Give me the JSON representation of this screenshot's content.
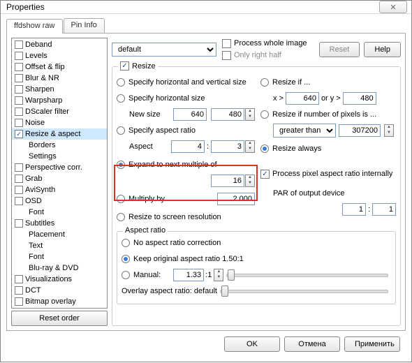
{
  "window": {
    "title": "Properties",
    "close_glyph": "✕"
  },
  "tabs": {
    "t0": "ffdshow raw",
    "t1": "Pin Info"
  },
  "tree": {
    "items": [
      {
        "label": "Deband",
        "lvl": 0,
        "cb": true,
        "ch": false
      },
      {
        "label": "Levels",
        "lvl": 0,
        "cb": true,
        "ch": false
      },
      {
        "label": "Offset & flip",
        "lvl": 0,
        "cb": true,
        "ch": false
      },
      {
        "label": "Blur & NR",
        "lvl": 0,
        "cb": true,
        "ch": false
      },
      {
        "label": "Sharpen",
        "lvl": 0,
        "cb": true,
        "ch": false
      },
      {
        "label": "Warpsharp",
        "lvl": 0,
        "cb": true,
        "ch": false
      },
      {
        "label": "DScaler filter",
        "lvl": 0,
        "cb": true,
        "ch": false
      },
      {
        "label": "Noise",
        "lvl": 0,
        "cb": true,
        "ch": false
      },
      {
        "label": "Resize & aspect",
        "lvl": 0,
        "cb": true,
        "ch": true,
        "sel": true
      },
      {
        "label": "Borders",
        "lvl": 1,
        "cb": false
      },
      {
        "label": "Settings",
        "lvl": 1,
        "cb": false
      },
      {
        "label": "Perspective corr.",
        "lvl": 0,
        "cb": true,
        "ch": false
      },
      {
        "label": "Grab",
        "lvl": 0,
        "cb": true,
        "ch": false
      },
      {
        "label": "AviSynth",
        "lvl": 0,
        "cb": true,
        "ch": false
      },
      {
        "label": "OSD",
        "lvl": 0,
        "cb": true,
        "ch": false
      },
      {
        "label": "Font",
        "lvl": 1,
        "cb": false
      },
      {
        "label": "Subtitles",
        "lvl": 0,
        "cb": true,
        "ch": false
      },
      {
        "label": "Placement",
        "lvl": 1,
        "cb": false
      },
      {
        "label": "Text",
        "lvl": 1,
        "cb": false
      },
      {
        "label": "Font",
        "lvl": 1,
        "cb": false
      },
      {
        "label": "Blu-ray & DVD",
        "lvl": 1,
        "cb": false
      },
      {
        "label": "Visualizations",
        "lvl": 0,
        "cb": true,
        "ch": false
      },
      {
        "label": "DCT",
        "lvl": 0,
        "cb": true,
        "ch": false
      },
      {
        "label": "Bitmap overlay",
        "lvl": 0,
        "cb": true,
        "ch": false
      }
    ],
    "reset_order": "Reset order"
  },
  "top": {
    "preset": "default",
    "whole": "Process whole image",
    "half": "Only right half",
    "reset": "Reset",
    "help": "Help"
  },
  "resize": {
    "legend": "Resize",
    "spec_hv": "Specify horizontal and vertical size",
    "spec_h": "Specify horizontal size",
    "new_size": "New size",
    "w": "640",
    "h": "480",
    "spec_ar": "Specify aspect ratio",
    "aspect": "Aspect",
    "ax": "4",
    "ay": "3",
    "expand": "Expand to next multiple of",
    "mult": "16",
    "multiply": "Multiply by",
    "mval": "2.000",
    "screen": "Resize to screen resolution",
    "if": "Resize if ...",
    "x": "x",
    "gt1": ">",
    "xv": "640",
    "or": "or",
    "y": "y",
    "gt2": ">",
    "yv": "480",
    "pixels": "Resize if number of pixels is ...",
    "gt_sel": "greater than",
    "pxv": "307200",
    "always": "Resize always",
    "par": "Process pixel aspect ratio internally",
    "par_out": "PAR of output device",
    "par1": "1",
    "par2": "1"
  },
  "ar": {
    "legend": "Aspect ratio",
    "none": "No aspect ratio correction",
    "keep": "Keep original aspect ratio 1.50:1",
    "manual": "Manual:",
    "mval": "1.33",
    "msuf": ":1",
    "overlay": "Overlay aspect ratio: default"
  },
  "colon": ":",
  "footer": {
    "ok": "OK",
    "cancel": "Отмена",
    "apply": "Применить"
  }
}
